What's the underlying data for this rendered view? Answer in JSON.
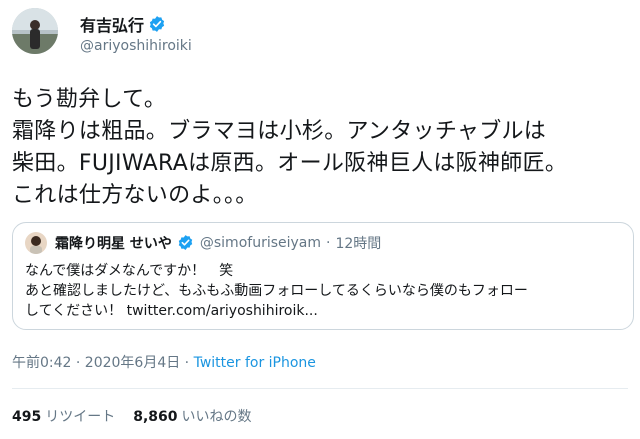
{
  "author": {
    "name": "有吉弘行",
    "handle": "@ariyoshihiroiki"
  },
  "tweet": {
    "text": "もう勘弁して。\n霜降りは粗品。ブラマヨは小杉。アンタッチャブルは\n柴田。FUJIWARAは原西。オール阪神巨人は阪神師匠。\nこれは仕方ないのよ。。。"
  },
  "quoted": {
    "name": "霜降り明星 せいや",
    "handle": "@simofuriseiyam",
    "dot": "·",
    "time": "12時間",
    "text": "なんで僕はダメなんですか！　笑\nあと確認しましたけど、もふもふ動画フォローしてるくらいなら僕のもフォロー\nしてください！ twitter.com/ariyoshihiroik..."
  },
  "meta": {
    "time": "午前0:42 · 2020年6月4日 · ",
    "source": "Twitter for iPhone"
  },
  "stats": {
    "retweets": "495",
    "retweets_label": "リツイート",
    "likes": "8,860",
    "likes_label": "いいねの数"
  },
  "colors": {
    "verified": "#1da1f2",
    "link": "#1b95e0",
    "muted": "#657786"
  },
  "icons": {
    "verified": "verified-badge-icon"
  }
}
